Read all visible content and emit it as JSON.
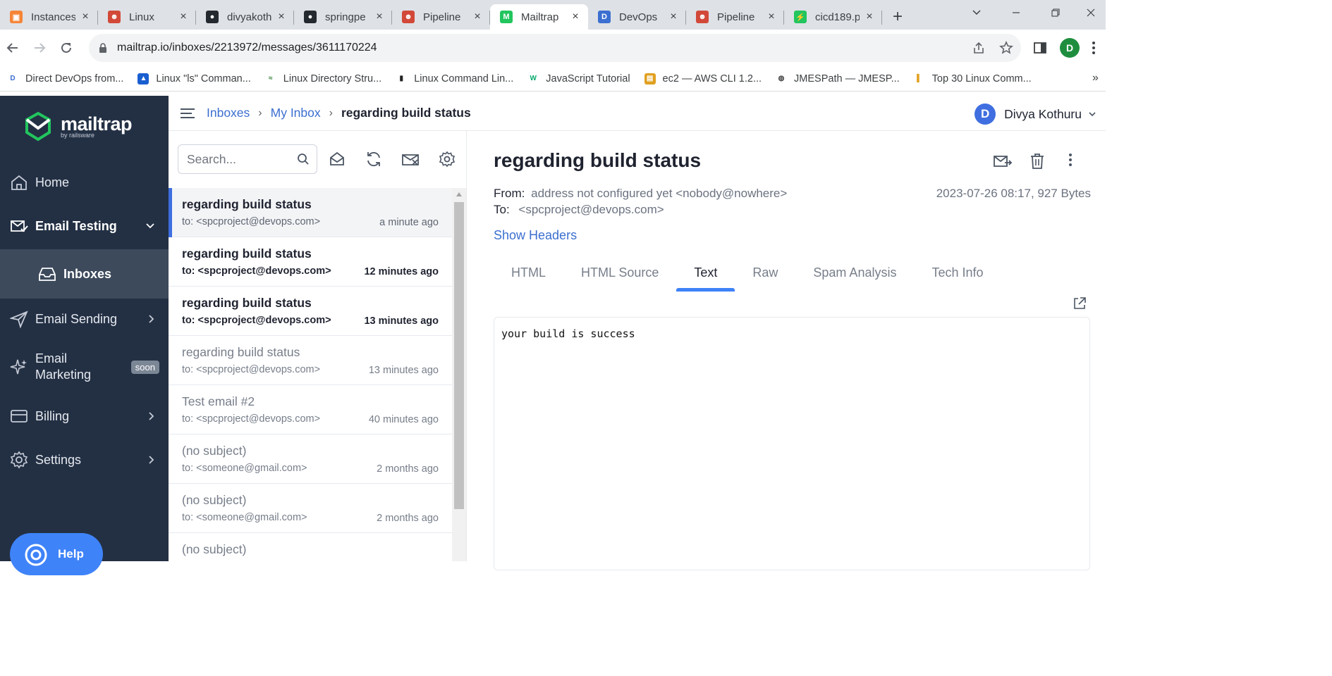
{
  "browser": {
    "tabs": [
      {
        "title": "Instances",
        "favicon": "aws-console-icon",
        "color": "#f58536",
        "active": false
      },
      {
        "title": "Linux",
        "favicon": "jenkins-icon",
        "color": "#d24939",
        "active": false
      },
      {
        "title": "divyakoth",
        "favicon": "github-icon",
        "color": "#24292f",
        "active": false
      },
      {
        "title": "springpe",
        "favicon": "github-icon",
        "color": "#24292f",
        "active": false
      },
      {
        "title": "Pipeline",
        "favicon": "jenkins-icon",
        "color": "#d24939",
        "active": false
      },
      {
        "title": "Mailtrap",
        "favicon": "mailtrap-icon",
        "color": "#22c55e",
        "active": true
      },
      {
        "title": "DevOps",
        "favicon": "devops-icon",
        "color": "#3b6fd0",
        "active": false
      },
      {
        "title": "Pipeline",
        "favicon": "jenkins-icon",
        "color": "#d24939",
        "active": false
      },
      {
        "title": "cicd189.p",
        "favicon": "bolt-icon",
        "color": "#22c55e",
        "active": false
      }
    ],
    "url": "mailtrap.io/inboxes/2213972/messages/3611170224",
    "profile_initial": "D",
    "bookmarks": [
      {
        "label": "Direct DevOps from...",
        "icon": "devops-icon"
      },
      {
        "label": "Linux \"ls\" Comman...",
        "icon": "linux-icon"
      },
      {
        "label": "Linux Directory Stru...",
        "icon": "gg-icon"
      },
      {
        "label": "Linux Command Lin...",
        "icon": "book-icon"
      },
      {
        "label": "JavaScript Tutorial",
        "icon": "w3schools-icon"
      },
      {
        "label": "ec2 — AWS CLI 1.2...",
        "icon": "aws-doc-icon"
      },
      {
        "label": "JMESPath — JMESP...",
        "icon": "globe-icon"
      },
      {
        "label": "Top 30 Linux Comm...",
        "icon": "chart-icon"
      }
    ]
  },
  "sidebar": {
    "logo": "mailtrap",
    "logo_sub": "by railsware",
    "items": [
      {
        "label": "Home"
      },
      {
        "label": "Email Testing"
      },
      {
        "label": "Inboxes"
      },
      {
        "label": "Email Sending"
      },
      {
        "label": "Email Marketing",
        "line1": "Email",
        "line2": "Marketing",
        "badge": "soon"
      },
      {
        "label": "Billing"
      },
      {
        "label": "Settings"
      }
    ],
    "help": "Help"
  },
  "breadcrumb": {
    "items": [
      "Inboxes",
      "My Inbox"
    ],
    "current": "regarding build status"
  },
  "user": {
    "initial": "D",
    "name": "Divya Kothuru"
  },
  "list": {
    "search_placeholder": "Search...",
    "messages": [
      {
        "subject": "regarding build status",
        "to": "to: <spcproject@devops.com>",
        "time": "a minute ago",
        "state": "selected"
      },
      {
        "subject": "regarding build status",
        "to": "to: <spcproject@devops.com>",
        "time": "12 minutes ago",
        "state": "unread"
      },
      {
        "subject": "regarding build status",
        "to": "to: <spcproject@devops.com>",
        "time": "13 minutes ago",
        "state": "unread"
      },
      {
        "subject": "regarding build status",
        "to": "to: <spcproject@devops.com>",
        "time": "13 minutes ago",
        "state": "read"
      },
      {
        "subject": "Test email #2",
        "to": "to: <spcproject@devops.com>",
        "time": "40 minutes ago",
        "state": "read"
      },
      {
        "subject": "(no subject)",
        "to": "to: <someone@gmail.com>",
        "time": "2 months ago",
        "state": "read"
      },
      {
        "subject": "(no subject)",
        "to": "to: <someone@gmail.com>",
        "time": "2 months ago",
        "state": "read"
      },
      {
        "subject": "(no subject)",
        "to": "",
        "time": "",
        "state": "read"
      }
    ]
  },
  "detail": {
    "title": "regarding build status",
    "from_label": "From:",
    "from_value": "address not configured yet <nobody@nowhere>",
    "to_label": "To:",
    "to_value": "<spcproject@devops.com>",
    "meta": "2023-07-26 08:17, 927 Bytes",
    "show_headers": "Show Headers",
    "tabs": [
      "HTML",
      "HTML Source",
      "Text",
      "Raw",
      "Spam Analysis",
      "Tech Info"
    ],
    "active_tab": "Text",
    "body": "your build is success"
  }
}
